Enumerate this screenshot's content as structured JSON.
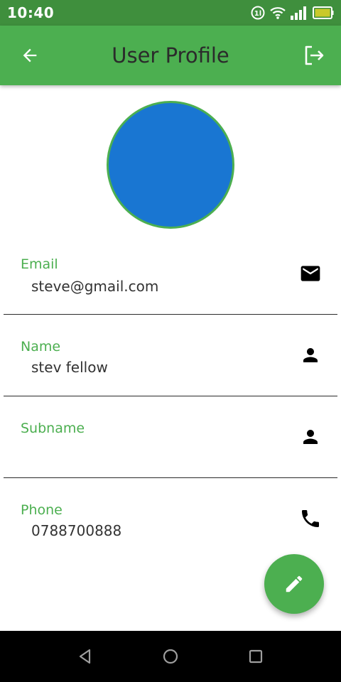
{
  "status_bar": {
    "time": "10:40",
    "icons": [
      "data-saver-icon",
      "wifi-icon",
      "signal-icon",
      "battery-icon"
    ]
  },
  "app_bar": {
    "title": "User Profile",
    "back_icon": "arrow-back-icon",
    "logout_icon": "logout-icon",
    "color": "#4caf50"
  },
  "avatar": {
    "color": "#1976d2",
    "border_color": "#4caf50"
  },
  "fields": [
    {
      "label": "Email",
      "value": "steve@gmail.com",
      "icon": "email-icon"
    },
    {
      "label": "Name",
      "value": "stev fellow",
      "icon": "person-icon"
    },
    {
      "label": "Subname",
      "value": "",
      "icon": "person-icon"
    },
    {
      "label": "Phone",
      "value": "0788700888",
      "icon": "phone-icon"
    }
  ],
  "fab": {
    "icon": "edit-icon"
  },
  "nav_bar": {
    "icons": [
      "nav-back-icon",
      "nav-home-icon",
      "nav-recents-icon"
    ]
  }
}
